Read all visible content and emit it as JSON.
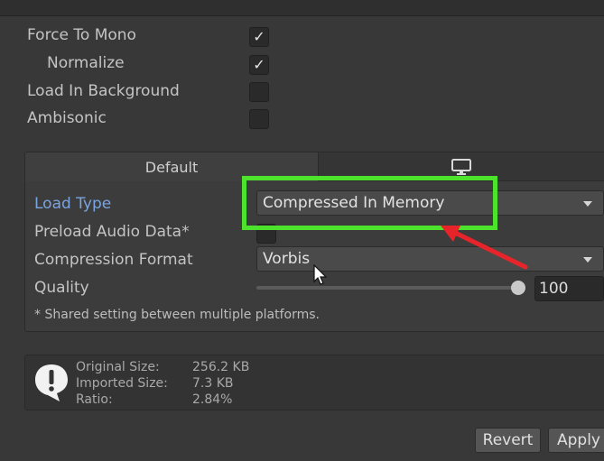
{
  "settings": {
    "force_to_mono": {
      "label": "Force To Mono",
      "checked": true,
      "glyph": "✓"
    },
    "normalize": {
      "label": "Normalize",
      "checked": true,
      "glyph": "✓"
    },
    "load_in_background": {
      "label": "Load In Background",
      "checked": false,
      "glyph": ""
    },
    "ambisonic": {
      "label": "Ambisonic",
      "checked": false,
      "glyph": ""
    }
  },
  "platform_tabs": {
    "default_label": "Default",
    "platform_icon": "monitor-icon"
  },
  "fields": {
    "load_type": {
      "label": "Load Type",
      "value": "Compressed In Memory"
    },
    "preload_audio_data": {
      "label": "Preload Audio Data*"
    },
    "compression_format": {
      "label": "Compression Format",
      "value": "Vorbis"
    },
    "quality": {
      "label": "Quality",
      "value": "100",
      "level": 1.0
    }
  },
  "note": "* Shared setting between multiple platforms.",
  "info": {
    "icon": "exclamation-speech-icon",
    "original_size": {
      "label": "Original Size:",
      "value": "256.2 KB"
    },
    "imported_size": {
      "label": "Imported Size:",
      "value": "7.3 KB"
    },
    "ratio": {
      "label": "Ratio:",
      "value": "2.84%"
    }
  },
  "buttons": {
    "revert": "Revert",
    "apply": "Apply"
  },
  "colors": {
    "highlight": "#4de22b",
    "annotation_arrow": "#e8242b",
    "active_label": "#7aa4e0"
  }
}
